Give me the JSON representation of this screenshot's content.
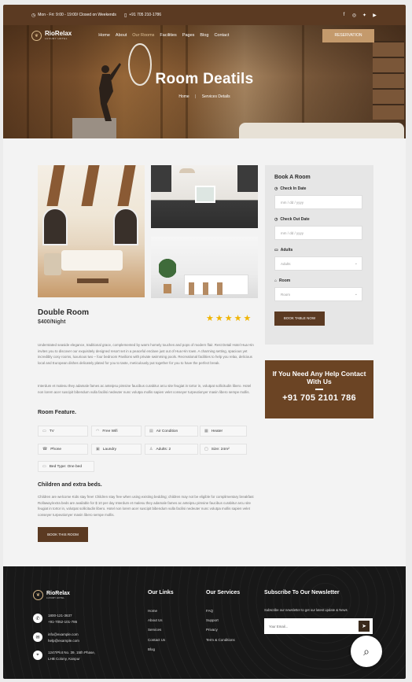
{
  "topbar": {
    "hours": "Mon - Fri: 9:00 - 19:00/ Closed on Weekends",
    "phone": "+91 705 210-1786",
    "socials": [
      "facebook-icon",
      "instagram-icon",
      "twitter-icon",
      "youtube-icon"
    ]
  },
  "nav": {
    "logo_name": "RioRelax",
    "logo_sub": "LUXURY HOTEL",
    "items": [
      "Home",
      "About",
      "Our Rooms",
      "Facilities",
      "Pages",
      "Blog",
      "Contact"
    ],
    "active": "Our Rooms",
    "reserve_label": "RESERVATION"
  },
  "hero": {
    "title": "Room Deatils",
    "crumb_home": "Home",
    "crumb_sep": "|",
    "crumb_current": "Services Details"
  },
  "room": {
    "title": "Double Room",
    "price": "$400/Night",
    "rating": 5,
    "para1": "Understated seaside elegance, traditional grace, complemented by warm homely touches and pops of modern flair. Rest Detail Hotel Hua Hin invites you to discover our exquisitely designed resort set in a peaceful enclave just out of Hua Hin town. A charming setting, spacious yet incredibly cosy rooms, luxurious two – four bedroom Pavilions with private swimming pools. Recreational facilities to help you relax, delicious local and European dishes delicately plated for you to taste, meticulously put together for you to have the perfect break.",
    "para2": "Interdum et malesu they adamale fames ac anteipsu pimsine faucibus curabitur arcu site feugiat in tortor in, volutpat sollicitudin libero. Hotel non lorem acer suscipit bibendum vulla facilisi nedeuter nunc volutpa mollis sapien velet conseyer turpeutionyer masin libero sempe mollis."
  },
  "features": {
    "heading": "Room Feature.",
    "items": [
      {
        "icon": "tv-icon",
        "label": "TV"
      },
      {
        "icon": "wifi-icon",
        "label": "Free Wifi"
      },
      {
        "icon": "air-condition-icon",
        "label": "Air Condition"
      },
      {
        "icon": "heater-icon",
        "label": "Heater"
      },
      {
        "icon": "phone-icon",
        "label": "Phone"
      },
      {
        "icon": "laundry-icon",
        "label": "Laundry"
      },
      {
        "icon": "adults-icon",
        "label": "Adults: 2"
      },
      {
        "icon": "size-icon",
        "label": "Size: 24m²"
      },
      {
        "icon": "bed-icon",
        "label": "Bed Type: One bed"
      }
    ]
  },
  "children": {
    "heading": "Children and extra beds.",
    "text": "Children are welcome Kids stay free! Children stay free when using existing bedding; children may not be eligible for complimentary breakfast Rollaway/extra beds are available for $ 10 per day Interdum et malesu they adamale fames ac anteipsu pimsine faucibus curabitur arcu site feugiat in tortor in, volutpat sollicitudin libero. Hotel non lorem acer suscipit bibendum vulla facilisi nedeuter nunc volutpa mollis sapien velet conseyer turpeutionyer masin libero sempe mollis.",
    "button": "BOOK THIS ROOM"
  },
  "booking": {
    "title": "Book A Room",
    "checkin_label": "Check In Date",
    "checkin_placeholder": "mm / dd / yyyy",
    "checkout_label": "Check Out Date",
    "checkout_placeholder": "mm / dd / yyyy",
    "adults_label": "Adults",
    "adults_value": "Adults",
    "room_label": "Room",
    "room_value": "Room",
    "button": "BOOK TABLE NOW"
  },
  "help": {
    "title": "If You Need Any Help Contact With Us",
    "phone": "+91 705 2101 786"
  },
  "footer": {
    "logo_name": "RioRelax",
    "logo_sub": "LUXURY HOTEL",
    "phones": [
      "1800-121-3637",
      "+91-7052-101-786"
    ],
    "emails": [
      "info@example.com",
      "help@example.com"
    ],
    "address": [
      "1247/Plot No. 39, 15th Phase,",
      "LHB Colony, Kanpur"
    ],
    "links_heading": "Our Links",
    "links": [
      "Home",
      "About Us",
      "Services",
      "Contact Us",
      "Blog"
    ],
    "services_heading": "Our Services",
    "services": [
      "FAQ",
      "Support",
      "Privacy",
      "Term & Conditions"
    ],
    "newsletter_heading": "Subscribe To Our Newsletter",
    "newsletter_text": "Subscribe our newsletter to get our latest update & News",
    "email_placeholder": "Your Email..."
  },
  "colors": {
    "brand_brown": "#5b3a22",
    "accent_gold": "#c49a6c",
    "star": "#f0b400",
    "footer_bg": "#181818"
  }
}
